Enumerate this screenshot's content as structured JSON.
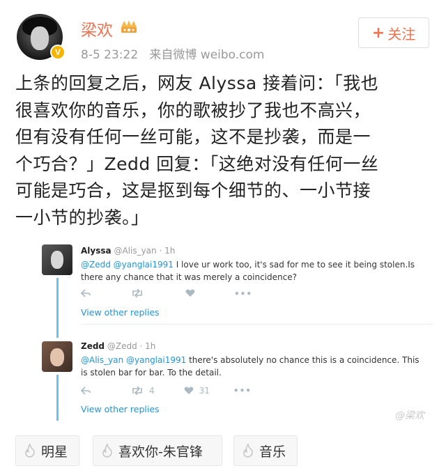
{
  "user": {
    "name": "梁欢",
    "time": "8-5 23:22",
    "source": "来自微博 weibo.com",
    "verified_badge": "V",
    "accent_color": "#eb7350"
  },
  "follow_button": {
    "plus": "+",
    "label": "关注"
  },
  "post": {
    "lines": [
      "上条的回复之后，网友 Alyssa 接着问：「我也",
      "很喜欢你的音乐，你的歌被抄了我也不高兴，",
      "但有没有任何一丝可能，这不是抄袭，而是一",
      "个巧合？」Zedd 回复：「这绝对没有任何一丝",
      "可能是巧合，这是抠到每个细节的、一小节接",
      "一小节的抄袭。」"
    ]
  },
  "tweets": [
    {
      "name": "Alyssa",
      "handle": "@Alis_yan · 1h",
      "mentions": "@Zedd @yanglai1991",
      "text_line1": " I love ur work too, it's sad for me to see it being stolen.Is",
      "text_line2": "there any chance that it was merely a coincidence?",
      "retweets": "",
      "likes": "",
      "link": "View other replies"
    },
    {
      "name": "Zedd",
      "handle": "@Zedd · 1h",
      "mentions": "@Alis_yan @yanglai1991",
      "text_line1": " there's absolutely no chance this is a coincidence. This",
      "text_line2": "is stolen bar for bar. To the detail.",
      "retweets": "4",
      "likes": "31",
      "link": "View other replies"
    }
  ],
  "watermark": "@梁欢",
  "tags": [
    {
      "label": "明星",
      "icon": "flame-icon"
    },
    {
      "label": "喜欢你-朱官锋",
      "icon": "flame-icon"
    },
    {
      "label": "音乐",
      "icon": "flame-icon"
    }
  ]
}
